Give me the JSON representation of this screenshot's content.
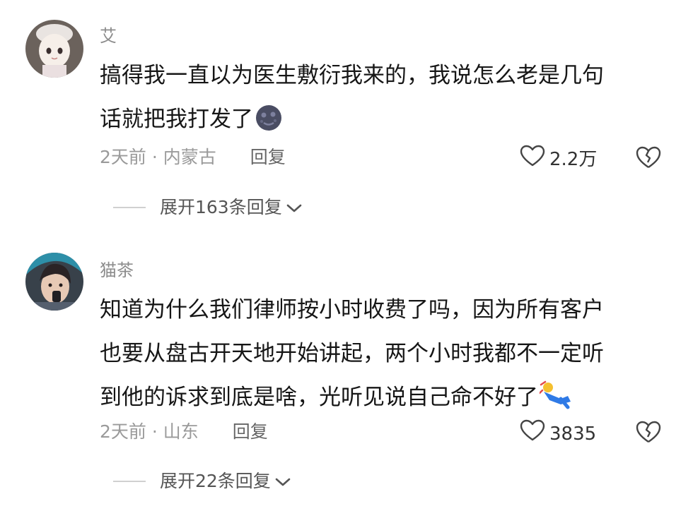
{
  "comments": [
    {
      "username": "艾",
      "lines": [
        "搞得我一直以为医生敷衍我来的，我说怎么老是几句",
        "话就把我打发了"
      ],
      "time_location": "2天前 · 内蒙古",
      "reply_label": "回复",
      "likes": "2.2万",
      "expand_label": "展开163条回复",
      "emoji": "dark-moon-face-icon"
    },
    {
      "username": "猫茶",
      "lines": [
        "知道为什么我们律师按小时收费了吗，因为所有客户",
        "也要从盘古开天地开始讲起，两个小时我都不一定听",
        "到他的诉求到底是啥，光听见说自己命不好了"
      ],
      "time_location": "2天前 · 山东",
      "reply_label": "回复",
      "likes": "3835",
      "expand_label": "展开22条回复",
      "emoji": "falling-person-icon"
    }
  ],
  "colors": {
    "meta": "#9a9a9a",
    "text": "#161616",
    "accent_blue": "#2f7ae6"
  }
}
